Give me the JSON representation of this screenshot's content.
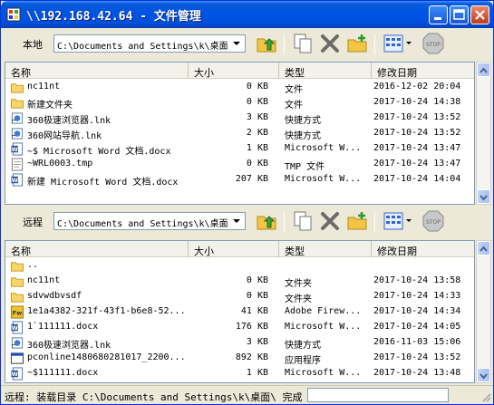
{
  "window": {
    "title": "\\\\192.168.42.64 - 文件管理"
  },
  "local": {
    "label": "本地",
    "path": "C:\\Documents and Settings\\k\\桌面",
    "columns": [
      "名称",
      "大小",
      "类型",
      "修改日期"
    ],
    "rows": [
      {
        "name": "nc11nt",
        "size": "0 KB",
        "type": "文件",
        "date": "2016-12-02 20:04",
        "icon": "folder-icon"
      },
      {
        "name": "新建文件夹",
        "size": "0 KB",
        "type": "文件",
        "date": "2017-10-24 14:38",
        "icon": "folder-icon"
      },
      {
        "name": "360极速浏览器.lnk",
        "size": "3 KB",
        "type": "快捷方式",
        "date": "2017-10-24 13:52",
        "icon": "shortcut-icon"
      },
      {
        "name": "360网站导航.lnk",
        "size": "2 KB",
        "type": "快捷方式",
        "date": "2017-10-24 13:52",
        "icon": "shortcut-icon"
      },
      {
        "name": "~$ Microsoft Word 文档.docx",
        "size": "1 KB",
        "type": "Microsoft W...",
        "date": "2017-10-24 13:47",
        "icon": "word-doc-icon"
      },
      {
        "name": "~WRL0003.tmp",
        "size": "0 KB",
        "type": "TMP 文件",
        "date": "2017-10-24 13:47",
        "icon": "tmp-file-icon"
      },
      {
        "name": "新建 Microsoft Word 文档.docx",
        "size": "207 KB",
        "type": "Microsoft W...",
        "date": "2017-10-24 14:04",
        "icon": "word-doc-icon"
      }
    ]
  },
  "remote": {
    "label": "远程",
    "path": "C:\\Documents and Settings\\k\\桌面",
    "columns": [
      "名称",
      "大小",
      "类型",
      "修改日期"
    ],
    "rows": [
      {
        "name": "..",
        "size": "",
        "type": "",
        "date": "",
        "icon": "folder-icon"
      },
      {
        "name": "nc11nt",
        "size": "0 KB",
        "type": "文件夹",
        "date": "2017-10-24 13:58",
        "icon": "folder-icon"
      },
      {
        "name": "sdvwdbvsdf",
        "size": "0 KB",
        "type": "文件夹",
        "date": "2017-10-24 14:33",
        "icon": "folder-icon"
      },
      {
        "name": "1e1a4382-321f-43f1-b6e8-52...",
        "size": "41 KB",
        "type": "Adobe Firew...",
        "date": "2017-10-24 14:34",
        "icon": "fireworks-file-icon"
      },
      {
        "name": "1`111111.docx",
        "size": "176 KB",
        "type": "Microsoft W...",
        "date": "2017-10-24 14:05",
        "icon": "word-doc-icon"
      },
      {
        "name": "360极速浏览器.lnk",
        "size": "3 KB",
        "type": "快捷方式",
        "date": "2016-11-03 15:06",
        "icon": "shortcut-icon"
      },
      {
        "name": "pconline1480680281017_2200...",
        "size": "892 KB",
        "type": "应用程序",
        "date": "2017-10-24 13:52",
        "icon": "exe-icon"
      },
      {
        "name": "~$111111.docx",
        "size": "1 KB",
        "type": "Microsoft W...",
        "date": "2017-10-24 13:48",
        "icon": "word-doc-icon"
      }
    ]
  },
  "status": {
    "text": "远程: 装载目录 C:\\Documents and Settings\\k\\桌面\\ 完成",
    "input": ""
  }
}
